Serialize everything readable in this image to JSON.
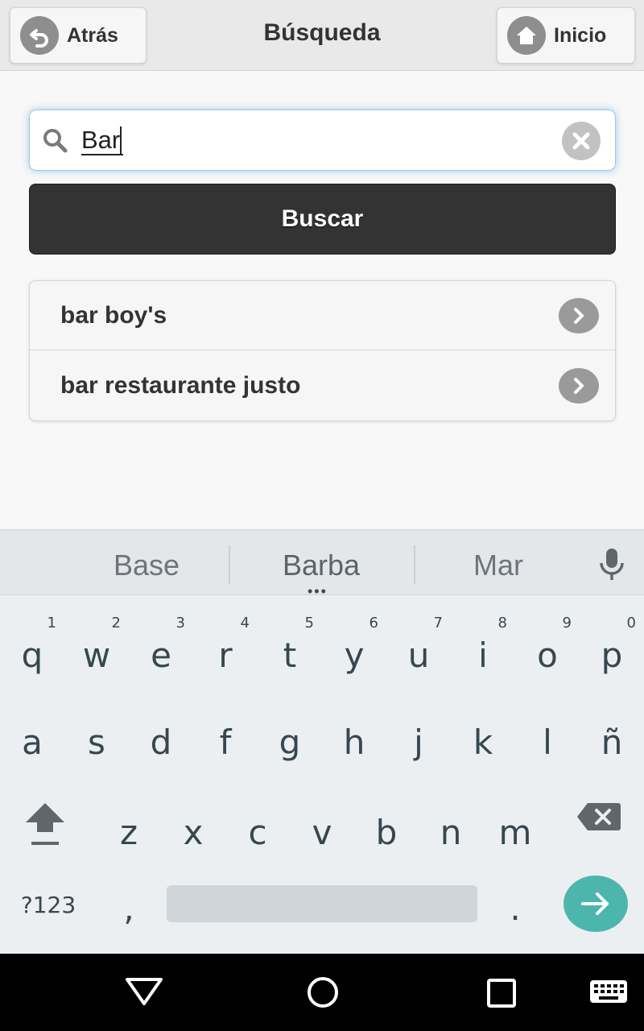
{
  "header": {
    "back_label": "Atrás",
    "title": "Búsqueda",
    "home_label": "Inicio"
  },
  "search": {
    "value": "Bar",
    "button_label": "Buscar"
  },
  "results": [
    {
      "label": "bar boy's"
    },
    {
      "label": "bar restaurante justo"
    }
  ],
  "keyboard": {
    "suggestions": [
      "Base",
      "Barba",
      "Mar"
    ],
    "row1": [
      {
        "ch": "q",
        "num": "1"
      },
      {
        "ch": "w",
        "num": "2"
      },
      {
        "ch": "e",
        "num": "3"
      },
      {
        "ch": "r",
        "num": "4"
      },
      {
        "ch": "t",
        "num": "5"
      },
      {
        "ch": "y",
        "num": "6"
      },
      {
        "ch": "u",
        "num": "7"
      },
      {
        "ch": "i",
        "num": "8"
      },
      {
        "ch": "o",
        "num": "9"
      },
      {
        "ch": "p",
        "num": "0"
      }
    ],
    "row2": [
      "a",
      "s",
      "d",
      "f",
      "g",
      "h",
      "j",
      "k",
      "l",
      "ñ"
    ],
    "row3": [
      "z",
      "x",
      "c",
      "v",
      "b",
      "n",
      "m"
    ],
    "symbols_label": "?123",
    "comma": ",",
    "period": "."
  },
  "colors": {
    "accent_enter": "#4db6ac",
    "button_dark": "#333333",
    "focus_glow": "#388ee0"
  }
}
